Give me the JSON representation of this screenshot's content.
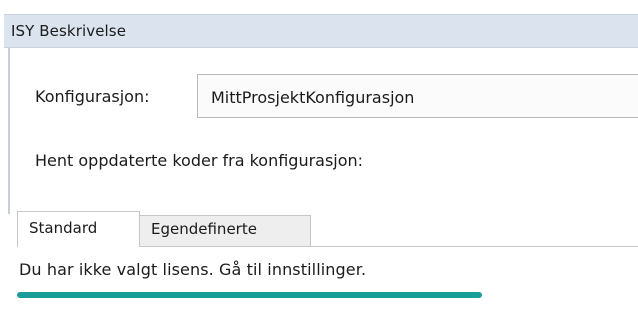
{
  "window": {
    "title": "ISY Beskrivelse"
  },
  "config": {
    "label": "Konfigurasjon:",
    "selected_value": "MittProsjektKonfigurasjon"
  },
  "update": {
    "label": "Hent oppdaterte koder fra konfigurasjon:"
  },
  "tabs": [
    {
      "label": "Standard",
      "active": true
    },
    {
      "label": "Egendefinerte",
      "active": false
    }
  ],
  "message": {
    "text": "Du har ikke valgt lisens. Gå til innstillinger."
  },
  "colors": {
    "titlebar": "#dbe3ef",
    "highlight_underline": "#1a9e9a",
    "inactive_tab": "#eeeeee"
  }
}
